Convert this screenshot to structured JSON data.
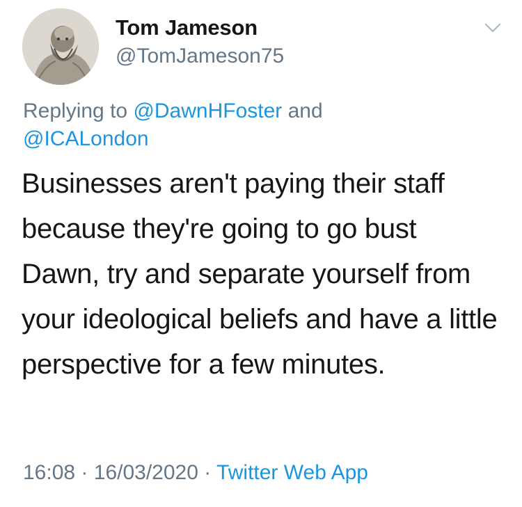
{
  "tweet": {
    "display_name": "Tom Jameson",
    "handle": "@TomJameson75",
    "replying_prefix": "Replying to",
    "reply_to_1": "@DawnHFoster",
    "reply_joiner": "and",
    "reply_to_2": "@ICALondon",
    "text": "Businesses aren't paying their staff because they're going to go bust Dawn, try and separate yourself from your ideological beliefs and have a little perspective for a few minutes.",
    "time": "16:08",
    "separator": "·",
    "date": "16/03/2020",
    "source": "Twitter Web App"
  },
  "icons": {
    "menu": "chevron-down-icon",
    "avatar": "avatar"
  },
  "colors": {
    "link": "#1b95e0",
    "secondary_text": "#657786",
    "primary_text": "#14171a",
    "background": "#ffffff"
  }
}
